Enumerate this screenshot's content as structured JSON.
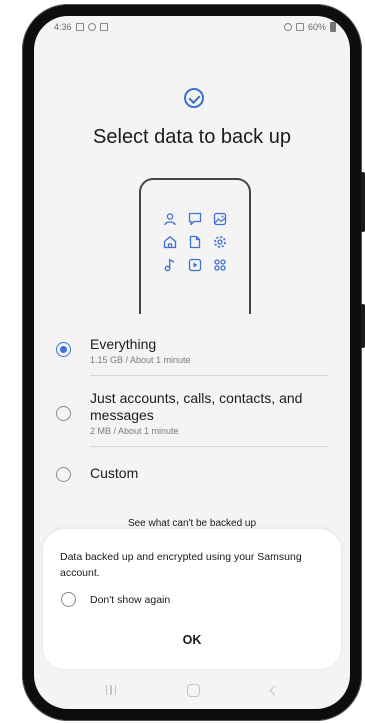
{
  "status_bar": {
    "time": "4:36",
    "battery": "60%"
  },
  "page": {
    "title": "Select data to back up"
  },
  "illustration": {
    "icons": [
      "person-icon",
      "chat-icon",
      "gallery-icon",
      "home-icon",
      "document-icon",
      "settings-icon",
      "music-icon",
      "video-icon",
      "apps-icon"
    ]
  },
  "options": [
    {
      "title": "Everything",
      "subtitle": "1.15 GB / About 1 minute",
      "selected": true
    },
    {
      "title": "Just accounts, calls, contacts, and messages",
      "subtitle": "2 MB / About 1 minute",
      "selected": false
    },
    {
      "title": "Custom",
      "subtitle": "",
      "selected": false
    }
  ],
  "see_link": "See what can't be backed up",
  "dialog": {
    "message": "Data backed up and encrypted using your Samsung account.",
    "checkbox_label": "Don't show again",
    "ok_label": "OK"
  },
  "colors": {
    "accent": "#3e6fd6",
    "background": "#f4f4f4",
    "dialog": "#ffffff"
  }
}
